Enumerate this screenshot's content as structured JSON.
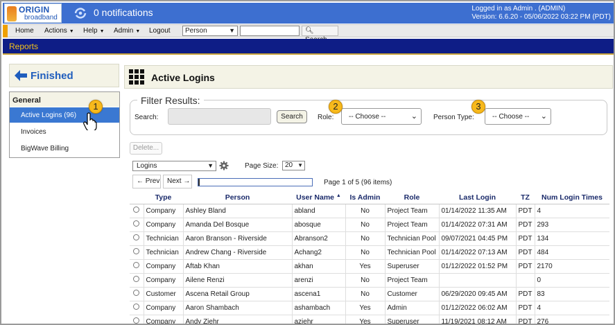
{
  "header": {
    "logo_line1": "ORIGIN",
    "logo_line2": "broadband",
    "notifications": "0 notifications",
    "login_line1": "Logged in as Admin . (ADMIN)",
    "login_line2": "Version: 6.6.20 - 05/06/2022 03:22 PM (PDT)"
  },
  "menu": {
    "items": [
      "Home",
      "Actions",
      "Help",
      "Admin",
      "Logout"
    ],
    "person_select": "Person",
    "search_value": "",
    "search_label": "Search"
  },
  "reports_bar": {
    "label": "Reports"
  },
  "left": {
    "finished_label": "Finished",
    "section": "General",
    "items": [
      "Active Logins (96)",
      "Invoices",
      "BigWave Billing"
    ]
  },
  "callouts": [
    "1",
    "2",
    "3"
  ],
  "main": {
    "title": "Active Logins",
    "filter_legend": "Filter Results:",
    "search_label": "Search:",
    "search_value": "",
    "search_button": "Search",
    "role_label": "Role:",
    "role_value": "-- Choose --",
    "person_type_label": "Person Type:",
    "person_type_value": "-- Choose --",
    "delete_button": "Delete...",
    "view_select": "Logins",
    "page_size_label": "Page Size:",
    "page_size_value": "20",
    "prev_button": "← Prev",
    "next_button": "Next →",
    "page_info": "Page 1 of 5 (96 items)",
    "page_progress": 0.2,
    "columns": [
      "",
      "Type",
      "Person",
      "User Name",
      "Is Admin",
      "Role",
      "Last Login",
      "TZ",
      "Num Login Times"
    ],
    "rows": [
      [
        "Company",
        "Ashley Bland",
        "abland",
        "No",
        "Project Team",
        "01/14/2022 11:35 AM",
        "PDT",
        "4"
      ],
      [
        "Company",
        "Amanda Del Bosque",
        "abosque",
        "No",
        "Project Team",
        "01/14/2022 07:31 AM",
        "PDT",
        "293"
      ],
      [
        "Technician",
        "Aaron Branson - Riverside",
        "Abranson2",
        "No",
        "Technician Pool",
        "09/07/2021 04:45 PM",
        "PDT",
        "134"
      ],
      [
        "Technician",
        "Andrew Chang - Riverside",
        "Achang2",
        "No",
        "Technician Pool",
        "01/14/2022 07:13 AM",
        "PDT",
        "484"
      ],
      [
        "Company",
        "Aftab Khan",
        "akhan",
        "Yes",
        "Superuser",
        "01/12/2022 01:52 PM",
        "PDT",
        "2170"
      ],
      [
        "Company",
        "Ailene Renzi",
        "arenzi",
        "No",
        "Project Team",
        "",
        "",
        "0"
      ],
      [
        "Customer",
        "Ascena Retail Group",
        "ascena1",
        "No",
        "Customer",
        "06/29/2020 09:45 AM",
        "PDT",
        "83"
      ],
      [
        "Company",
        "Aaron Shambach",
        "ashambach",
        "Yes",
        "Admin",
        "01/12/2022 06:02 AM",
        "PDT",
        "4"
      ],
      [
        "Company",
        "Andy Ziehr",
        "aziehr",
        "Yes",
        "Superuser",
        "11/19/2021 08:12 AM",
        "PDT",
        "276"
      ]
    ]
  },
  "colors": {
    "topbar": "#3d6fd0",
    "reports_bar": "#0e1d86",
    "reports_text": "#f4c21a",
    "active_item": "#3a78d2",
    "callout": "#f7b91c"
  },
  "icons": [
    "notification-icon",
    "back-arrow-icon",
    "grid-icon",
    "gear-icon",
    "hand-cursor-icon",
    "chevron-down-icon"
  ]
}
